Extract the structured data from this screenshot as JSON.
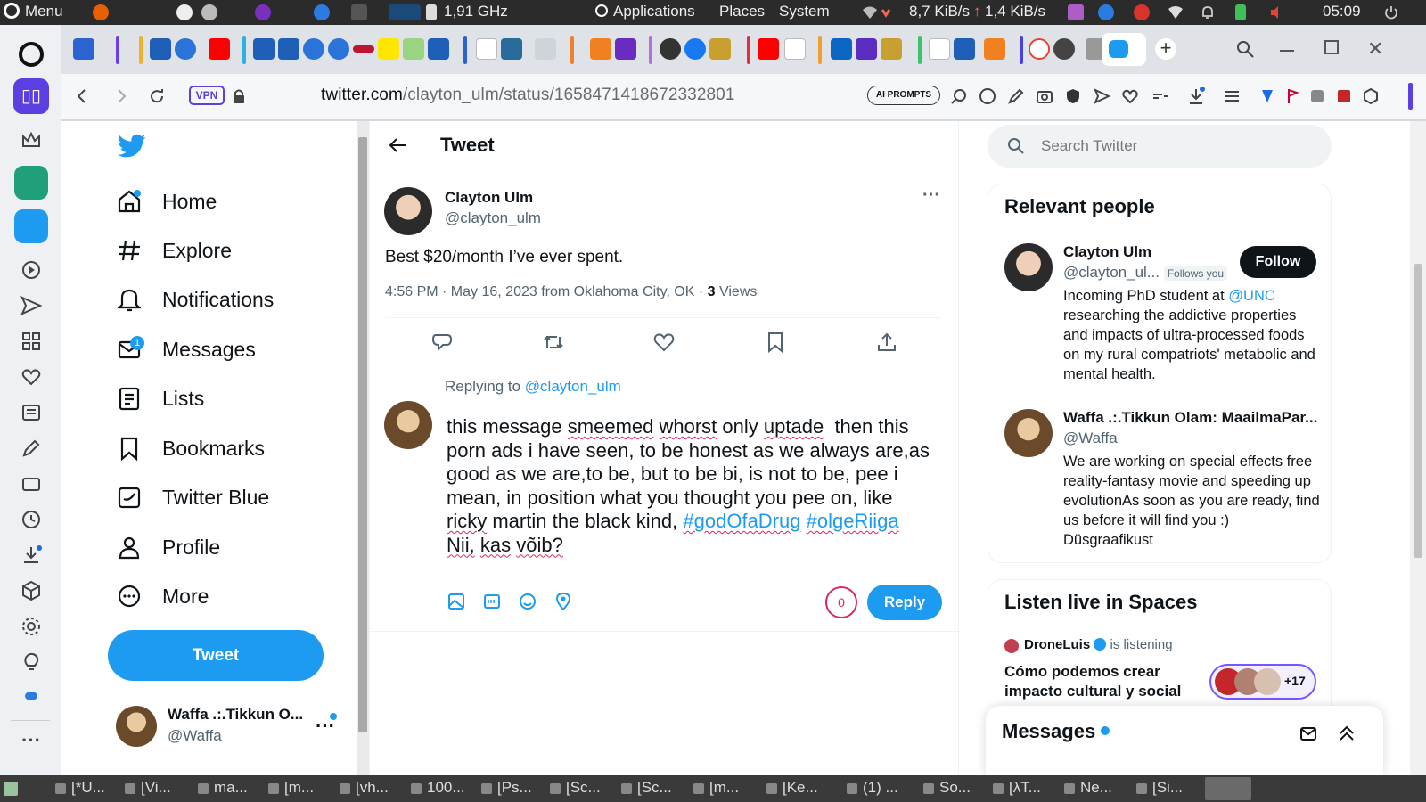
{
  "system_bar": {
    "menu": "Menu",
    "cpu_freq": "1,91 GHz",
    "applications": "Applications",
    "places": "Places",
    "system": "System",
    "net_down": "8,7 KiB/s",
    "net_up": "1,4 KiB/s",
    "time": "05:09"
  },
  "browser": {
    "url_host": "twitter.com",
    "url_path": "/clayton_ulm/status/1658471418672332801",
    "vpn_badge": "VPN",
    "ai_prompts": "AI PROMPTS"
  },
  "nav": {
    "items": [
      {
        "label": "Home",
        "icon": "home-icon"
      },
      {
        "label": "Explore",
        "icon": "hashtag-icon"
      },
      {
        "label": "Notifications",
        "icon": "bell-icon"
      },
      {
        "label": "Messages",
        "icon": "mail-icon",
        "badge": "1"
      },
      {
        "label": "Lists",
        "icon": "list-icon"
      },
      {
        "label": "Bookmarks",
        "icon": "bookmark-icon"
      },
      {
        "label": "Twitter Blue",
        "icon": "twitter-blue-icon"
      },
      {
        "label": "Profile",
        "icon": "profile-icon"
      },
      {
        "label": "More",
        "icon": "more-icon"
      }
    ],
    "tweet_button": "Tweet",
    "account_name": "Waffa .:.Tikkun O...",
    "account_handle": "@Waffa"
  },
  "header": {
    "title": "Tweet"
  },
  "tweet": {
    "author_name": "Clayton Ulm",
    "author_handle": "@clayton_ulm",
    "text": "Best $20/month I’ve ever spent.",
    "meta": "4:56 PM · May 16, 2023 from Oklahoma City, OK ·",
    "views_count": "3",
    "views_label": "Views"
  },
  "reply_box": {
    "replying_to_label": "Replying to",
    "replying_to_handle": "@clayton_ulm",
    "draft_lines": [
      "this message smeemed whorst only uptade  then this",
      "porn ads i have seen, to be honest as we always are,as",
      "good as we are,to be, but to be bi, is not to be, pee i",
      "mean, in position what you thought you pee on, like",
      "ricky martin the black kind, #godOfaDrug #olgeRiiga",
      "Nii, kas võib?"
    ],
    "char_count": "0",
    "reply_button": "Reply"
  },
  "right": {
    "search_placeholder": "Search Twitter",
    "relevant_title": "Relevant people",
    "people": [
      {
        "name": "Clayton Ulm",
        "handle": "@clayton_ul...",
        "follows_you": "Follows you",
        "follow_button": "Follow",
        "bio_prefix": "Incoming PhD student at",
        "bio_link": "@UNC",
        "bio_rest": "researching the addictive properties and impacts of ultra-processed foods on my rural compatriots' metabolic and mental health."
      },
      {
        "name": "Waffa .:.Tikkun Olam: MaailmaPar...",
        "handle": "@Waffa",
        "bio": "We are working on special effects free reality-fantasy movie and speeding up evolutionAs soon as you are ready, find us before it will find you :) Düsgraafikust"
      }
    ],
    "spaces_title": "Listen live in Spaces",
    "space_host": "DroneLuis",
    "space_status": "is listening",
    "space_title": "Cómo podemos crear impacto cultural y social",
    "space_count": "+17",
    "messages_title": "Messages"
  },
  "taskbar": {
    "tasks": [
      "[*U...",
      "[Vi...",
      "ma...",
      "[m...",
      "[vh...",
      "100...",
      "[Ps...",
      "[Sc...",
      "[Sc...",
      "[m...",
      "[Ke...",
      "(1) ...",
      "So...",
      "[λT...",
      "Ne...",
      "[Si..."
    ]
  },
  "colors": {
    "accent": "#1d9bf0",
    "text": "#0f1419",
    "muted": "#536471"
  }
}
